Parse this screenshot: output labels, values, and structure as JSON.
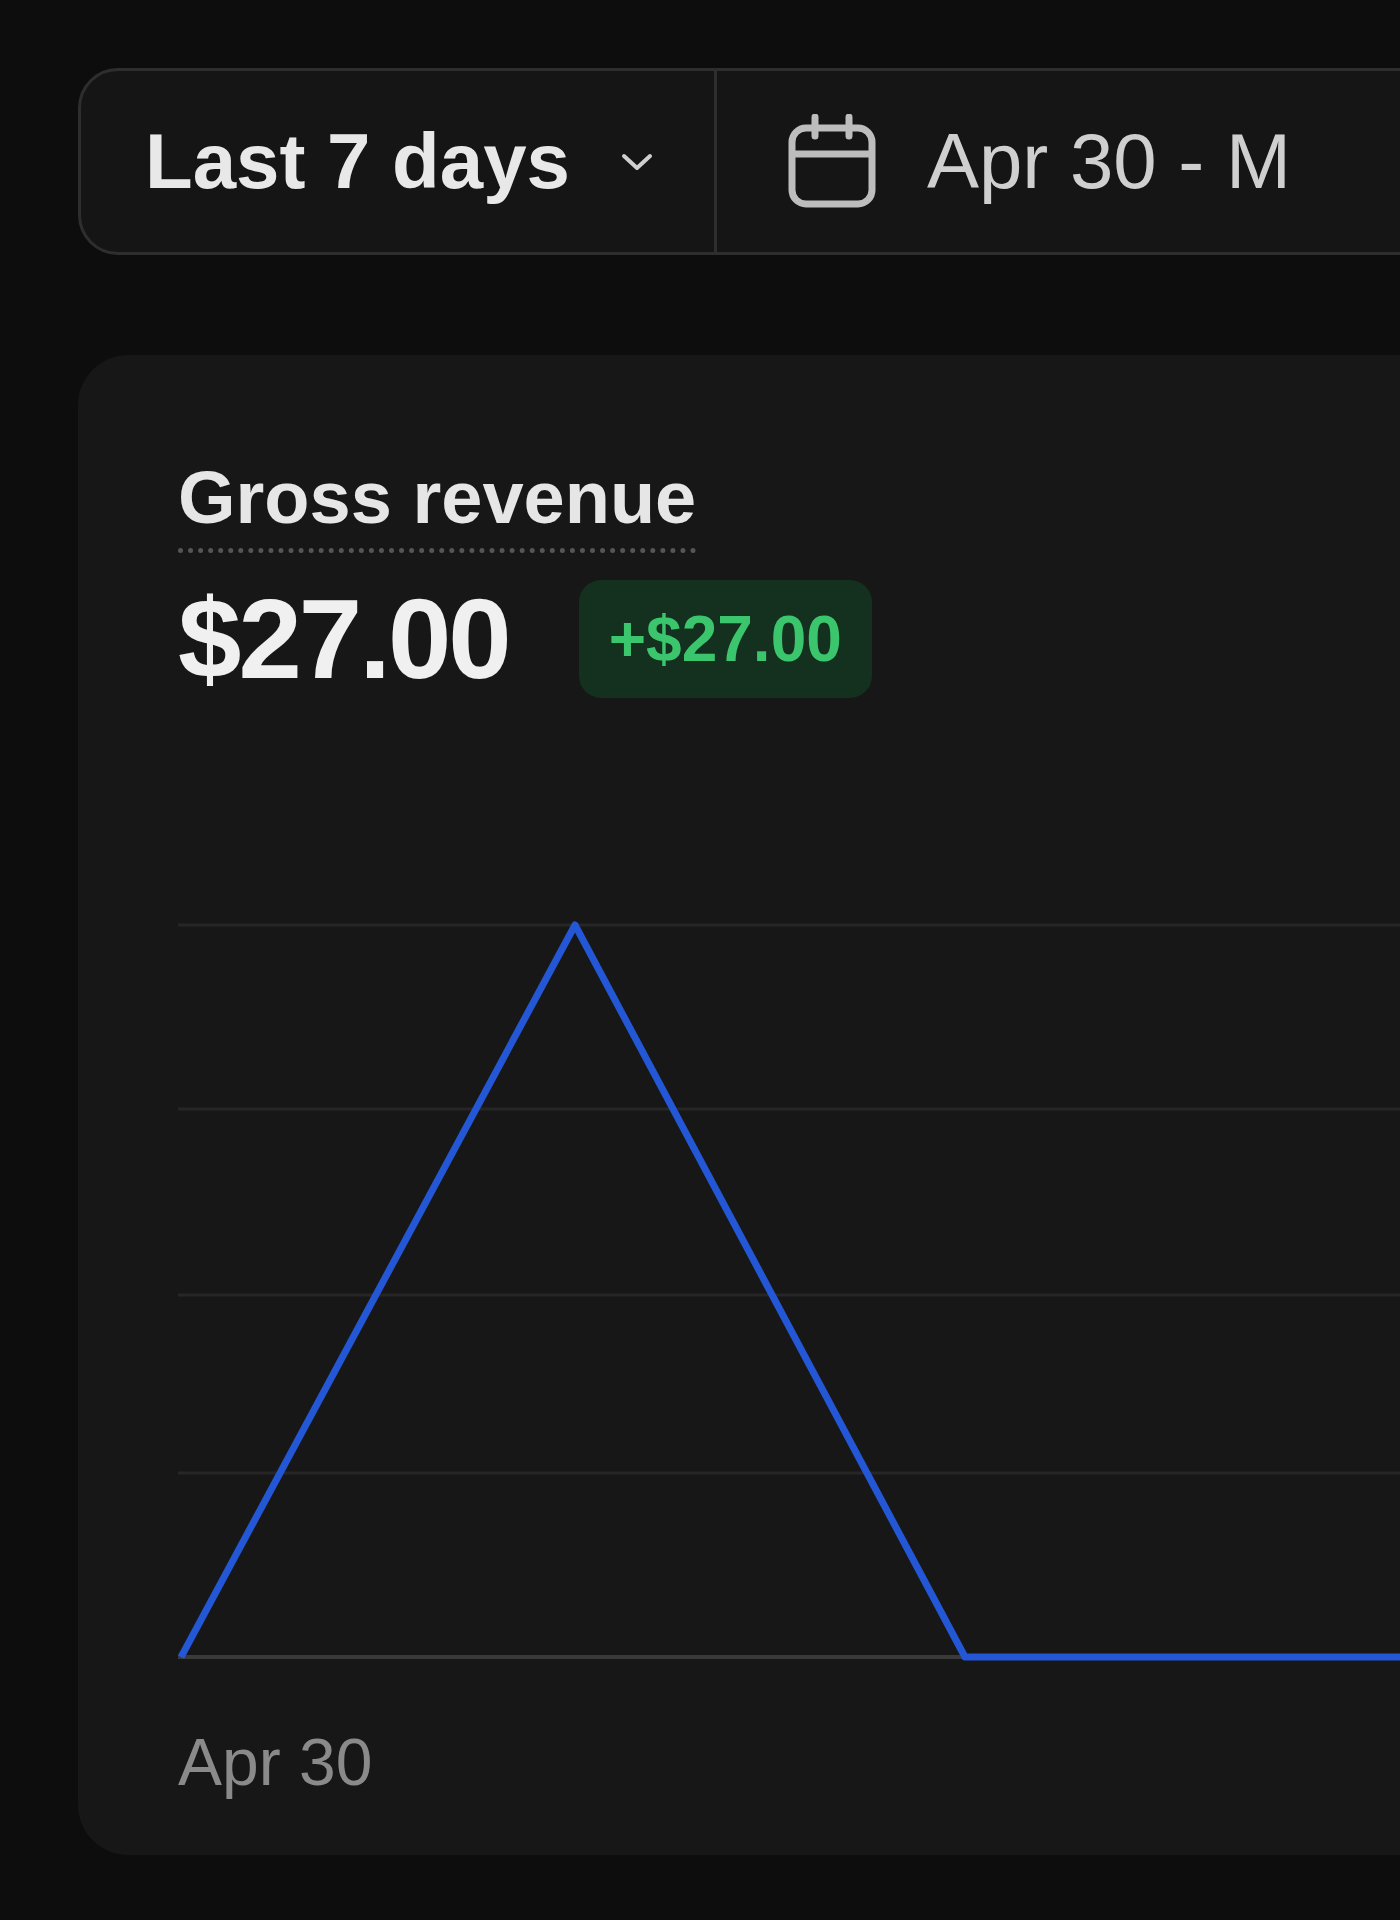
{
  "filters": {
    "range_select": {
      "value": "Last 7 days"
    },
    "date_range": {
      "value": "Apr 30 - M"
    }
  },
  "card": {
    "title": "Gross revenue",
    "value": "$27.00",
    "change": "+$27.00",
    "chart": {
      "x_labels": [
        "Apr 30"
      ]
    }
  }
}
